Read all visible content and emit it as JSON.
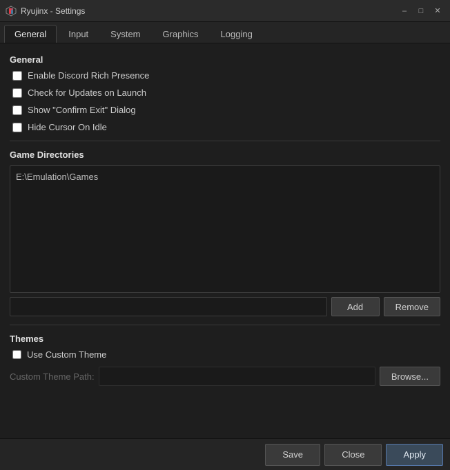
{
  "titlebar": {
    "logo_alt": "Ryujinx logo",
    "title": "Ryujinx - Settings",
    "minimize_label": "–",
    "maximize_label": "□",
    "close_label": "✕"
  },
  "tabs": [
    {
      "id": "general",
      "label": "General",
      "active": true
    },
    {
      "id": "input",
      "label": "Input",
      "active": false
    },
    {
      "id": "system",
      "label": "System",
      "active": false
    },
    {
      "id": "graphics",
      "label": "Graphics",
      "active": false
    },
    {
      "id": "logging",
      "label": "Logging",
      "active": false
    }
  ],
  "general_section": {
    "heading": "General",
    "checkboxes": [
      {
        "id": "discord",
        "label": "Enable Discord Rich Presence",
        "checked": false
      },
      {
        "id": "updates",
        "label": "Check for Updates on Launch",
        "checked": false
      },
      {
        "id": "confirm_exit",
        "label": "Show \"Confirm Exit\" Dialog",
        "checked": false
      },
      {
        "id": "hide_cursor",
        "label": "Hide Cursor On Idle",
        "checked": false
      }
    ]
  },
  "game_directories": {
    "heading": "Game Directories",
    "dirs": [
      "E:\\Emulation\\Games"
    ],
    "add_label": "Add",
    "remove_label": "Remove"
  },
  "themes": {
    "heading": "Themes",
    "use_custom_label": "Use Custom Theme",
    "use_custom_checked": false,
    "custom_path_label": "Custom Theme Path:",
    "custom_path_value": "",
    "custom_path_placeholder": "",
    "browse_label": "Browse..."
  },
  "bottom_bar": {
    "save_label": "Save",
    "close_label": "Close",
    "apply_label": "Apply"
  }
}
